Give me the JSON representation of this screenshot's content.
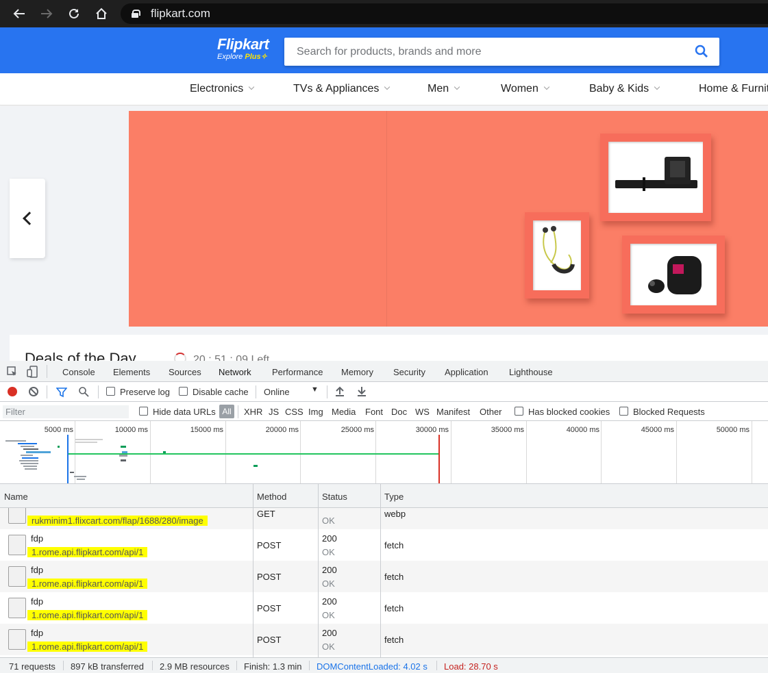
{
  "browser": {
    "url": "flipkart.com",
    "back_icon": "arrow-left-icon",
    "forward_icon": "arrow-right-icon",
    "reload_icon": "reload-icon",
    "home_icon": "home-icon"
  },
  "site": {
    "logo": "Flipkart",
    "logo_sub_prefix": "Explore",
    "logo_sub_plus": "Plus",
    "search_placeholder": "Search for products, brands and more",
    "brand_color": "#2874f0",
    "categories": [
      {
        "label": "Electronics"
      },
      {
        "label": "TVs & Appliances"
      },
      {
        "label": "Men"
      },
      {
        "label": "Women"
      },
      {
        "label": "Baby & Kids"
      },
      {
        "label": "Home & Furnit"
      }
    ],
    "banner_color": "#fb7e66",
    "deals_title": "Deals of the Day",
    "deals_timer": "20 : 51 : 09 Left"
  },
  "devtools": {
    "tabs": [
      "Console",
      "Elements",
      "Sources",
      "Network",
      "Performance",
      "Memory",
      "Security",
      "Application",
      "Lighthouse"
    ],
    "active_tab": "Network",
    "toolbar": {
      "preserve_log": "Preserve log",
      "disable_cache": "Disable cache",
      "throttle": "Online"
    },
    "filter": {
      "placeholder": "Filter",
      "hide_data_urls": "Hide data URLs",
      "all": "All",
      "types": [
        "XHR",
        "JS",
        "CSS",
        "Img",
        "Media",
        "Font",
        "Doc",
        "WS",
        "Manifest",
        "Other"
      ],
      "has_blocked_cookies": "Has blocked cookies",
      "blocked_requests": "Blocked Requests"
    },
    "overview_ticks": [
      "5000 ms",
      "10000 ms",
      "15000 ms",
      "20000 ms",
      "25000 ms",
      "30000 ms",
      "35000 ms",
      "40000 ms",
      "45000 ms",
      "50000 ms"
    ],
    "columns": [
      "Name",
      "Method",
      "Status",
      "Type"
    ],
    "rows": [
      {
        "name": "",
        "url": "rukminim1.flixcart.com/flap/1688/280/image",
        "method": "GET",
        "status": "",
        "status_text": "OK",
        "type": "webp"
      },
      {
        "name": "fdp",
        "url": "1.rome.api.flipkart.com/api/1",
        "method": "POST",
        "status": "200",
        "status_text": "OK",
        "type": "fetch"
      },
      {
        "name": "fdp",
        "url": "1.rome.api.flipkart.com/api/1",
        "method": "POST",
        "status": "200",
        "status_text": "OK",
        "type": "fetch"
      },
      {
        "name": "fdp",
        "url": "1.rome.api.flipkart.com/api/1",
        "method": "POST",
        "status": "200",
        "status_text": "OK",
        "type": "fetch"
      },
      {
        "name": "fdp",
        "url": "1.rome.api.flipkart.com/api/1",
        "method": "POST",
        "status": "200",
        "status_text": "OK",
        "type": "fetch"
      }
    ],
    "statusbar": {
      "requests": "71 requests",
      "transferred": "897 kB transferred",
      "resources": "2.9 MB resources",
      "finish": "Finish: 1.3 min",
      "dom_content_loaded": "DOMContentLoaded: 4.02 s",
      "load": "Load: 28.70 s"
    }
  }
}
